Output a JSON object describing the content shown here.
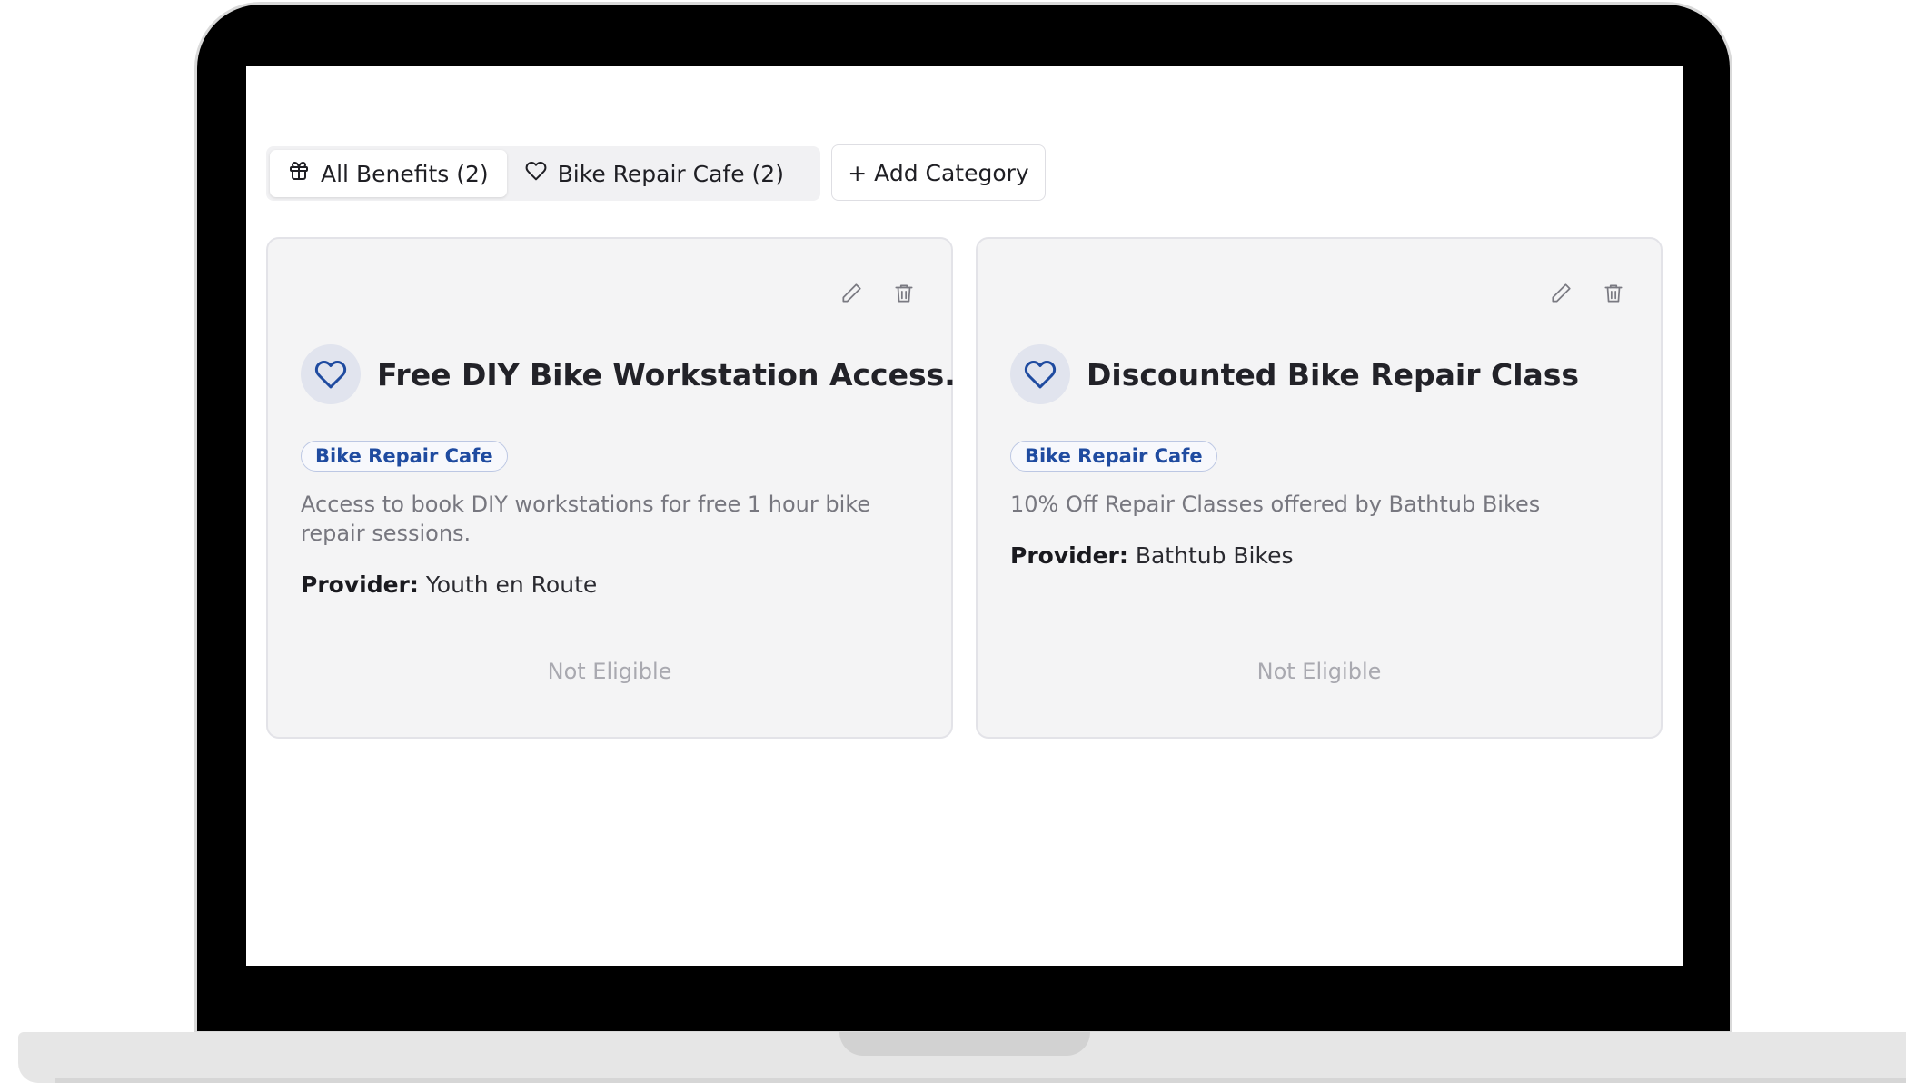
{
  "tabs": [
    {
      "label": "All Benefits (2)",
      "icon": "gift-icon",
      "active": true
    },
    {
      "label": "Bike Repair Cafe (2)",
      "icon": "heart-icon",
      "active": false
    }
  ],
  "add_category_label": "+ Add Category",
  "cards": [
    {
      "title": "Free DIY Bike Workstation Access.",
      "category": "Bike Repair Cafe",
      "description": "Access to book DIY workstations for free 1 hour bike repair sessions.",
      "provider_label": "Provider:",
      "provider": "Youth en Route",
      "status": "Not Eligible"
    },
    {
      "title": "Discounted Bike Repair Class",
      "category": "Bike Repair Cafe",
      "description": "10% Off Repair Classes offered by Bathtub Bikes",
      "provider_label": "Provider:",
      "provider": "Bathtub Bikes",
      "status": "Not Eligible"
    }
  ],
  "colors": {
    "accent": "#1f4ba0",
    "card_bg": "#f4f4f5",
    "muted_text": "#a9a9b0"
  }
}
